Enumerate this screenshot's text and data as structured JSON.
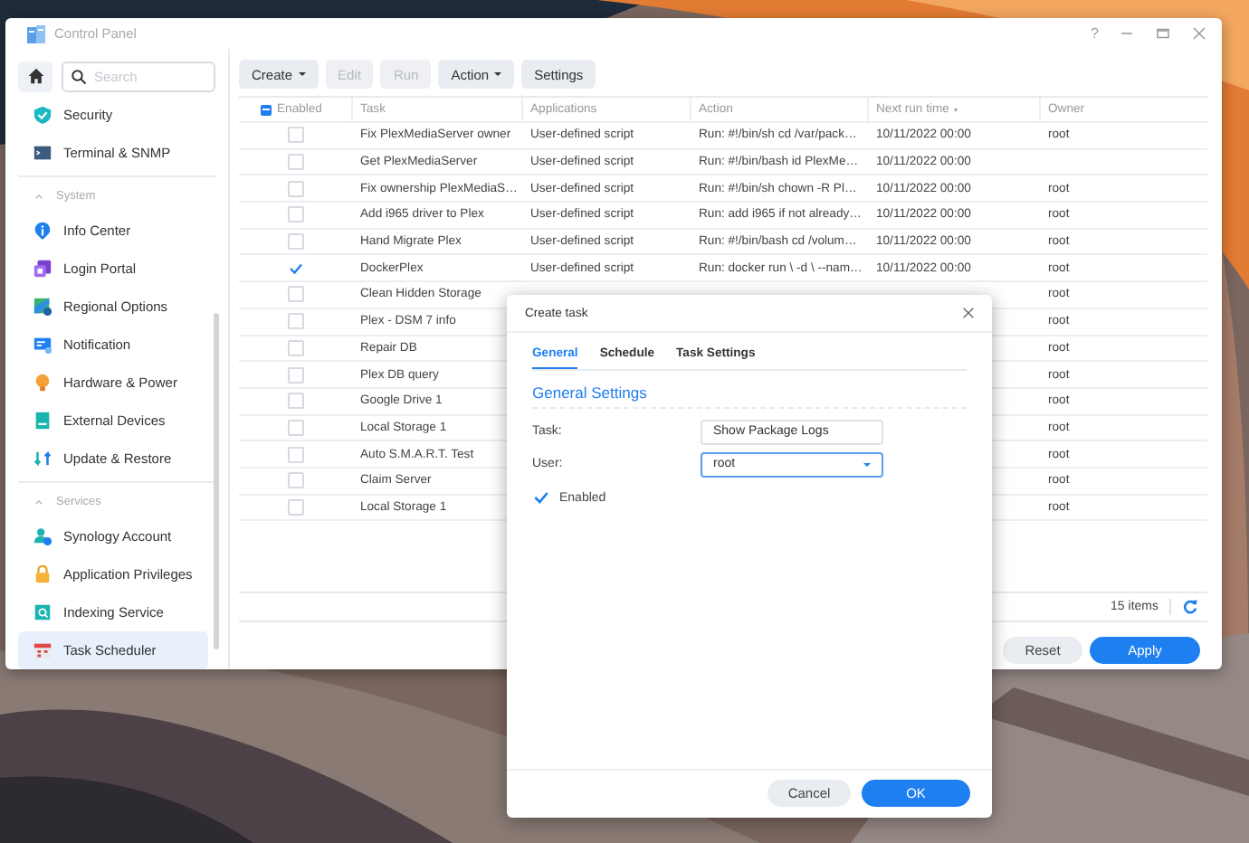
{
  "window": {
    "title": "Control Panel",
    "help": "?"
  },
  "sidebar": {
    "search": {
      "placeholder": "Search"
    },
    "sections": [
      {
        "items": [
          {
            "label": "Security",
            "selected": false
          },
          {
            "label": "Terminal & SNMP",
            "selected": false
          }
        ]
      },
      {
        "header": "System",
        "expanded": true,
        "items": [
          {
            "label": "Info Center",
            "selected": false
          },
          {
            "label": "Login Portal",
            "selected": false
          },
          {
            "label": "Regional Options",
            "selected": false
          },
          {
            "label": "Notification",
            "selected": false
          },
          {
            "label": "Hardware & Power",
            "selected": false
          },
          {
            "label": "External Devices",
            "selected": false
          },
          {
            "label": "Update & Restore",
            "selected": false
          }
        ]
      },
      {
        "header": "Services",
        "expanded": true,
        "items": [
          {
            "label": "Synology Account",
            "selected": false
          },
          {
            "label": "Application Privileges",
            "selected": false
          },
          {
            "label": "Indexing Service",
            "selected": false
          },
          {
            "label": "Task Scheduler",
            "selected": true
          }
        ]
      }
    ]
  },
  "toolbar": [
    {
      "label": "Create",
      "menu": true,
      "disabled": false
    },
    {
      "label": "Edit",
      "menu": false,
      "disabled": true
    },
    {
      "label": "Run",
      "menu": false,
      "disabled": true
    },
    {
      "label": "Action",
      "menu": true,
      "disabled": false
    },
    {
      "label": "Settings",
      "menu": false,
      "disabled": false
    }
  ],
  "table": {
    "columns": [
      {
        "label": "Enabled",
        "kind": "check",
        "mixed": true
      },
      {
        "label": "Task",
        "kind": "text"
      },
      {
        "label": "Applications",
        "kind": "text"
      },
      {
        "label": "Action",
        "kind": "text"
      },
      {
        "label": "Next run time",
        "kind": "text",
        "sorted": true
      },
      {
        "label": "Owner",
        "kind": "text"
      }
    ],
    "rows": [
      {
        "enabled": false,
        "task": "Fix PlexMediaServer owner",
        "applications": "User-defined script",
        "action": "Run: #!/bin/sh cd /var/pack…",
        "next_run": "10/11/2022 00:00",
        "owner": "root"
      },
      {
        "enabled": false,
        "task": "Get PlexMediaServer",
        "applications": "User-defined script",
        "action": "Run: #!/bin/bash id PlexMe…",
        "next_run": "10/11/2022 00:00"
      },
      {
        "enabled": false,
        "task": "Fix ownership PlexMediaS…",
        "applications": "User-defined script",
        "action": "Run: #!/bin/sh chown -R Pl…",
        "next_run": "10/11/2022 00:00",
        "owner": "root"
      },
      {
        "enabled": false,
        "task": "Add i965 driver to Plex",
        "applications": "User-defined script",
        "action": "Run: add i965 if not already…",
        "next_run": "10/11/2022 00:00",
        "owner": "root"
      },
      {
        "enabled": false,
        "task": "Hand Migrate Plex",
        "applications": "User-defined script",
        "action": "Run: #!/bin/bash cd /volum…",
        "next_run": "10/11/2022 00:00",
        "owner": "root"
      },
      {
        "enabled": true,
        "task": "DockerPlex",
        "applications": "User-defined script",
        "action": "Run: docker run \\ -d \\ --nam…",
        "next_run": "10/11/2022 00:00",
        "owner": "root"
      },
      {
        "enabled": false,
        "task": "Clean Hidden Storage",
        "owner": "root"
      },
      {
        "enabled": false,
        "task": "Plex - DSM 7 info",
        "owner": "root"
      },
      {
        "enabled": false,
        "task": "Repair DB",
        "owner": "root"
      },
      {
        "enabled": false,
        "task": "Plex DB query",
        "owner": "root"
      },
      {
        "enabled": false,
        "task": "Google Drive 1",
        "owner": "root"
      },
      {
        "enabled": false,
        "task": "Local Storage 1",
        "owner": "root"
      },
      {
        "enabled": false,
        "task": "Auto S.M.A.R.T. Test",
        "owner": "root"
      },
      {
        "enabled": false,
        "task": "Claim Server",
        "owner": "root"
      },
      {
        "enabled": false,
        "task": "Local Storage 1",
        "owner": "root"
      }
    ],
    "count": "15 items"
  },
  "buttons": [
    {
      "label": "Reset",
      "kind": "secondary"
    },
    {
      "label": "Apply",
      "kind": "primary"
    }
  ],
  "dialog": {
    "title": "Create task",
    "tabs": [
      {
        "label": "General",
        "selected": true
      },
      {
        "label": "Schedule",
        "selected": false
      },
      {
        "label": "Task Settings",
        "selected": false
      }
    ],
    "section": "General Settings",
    "fields": [
      {
        "label": "Task:",
        "kind": "text",
        "value": "Show Package Logs",
        "focused": false
      },
      {
        "label": "User:",
        "kind": "select",
        "value": "root",
        "focused": true
      }
    ],
    "checkbox": {
      "label": "Enabled",
      "checked": true
    },
    "buttons": [
      {
        "label": "Cancel",
        "kind": "secondary"
      },
      {
        "label": "OK",
        "kind": "primary"
      }
    ]
  }
}
